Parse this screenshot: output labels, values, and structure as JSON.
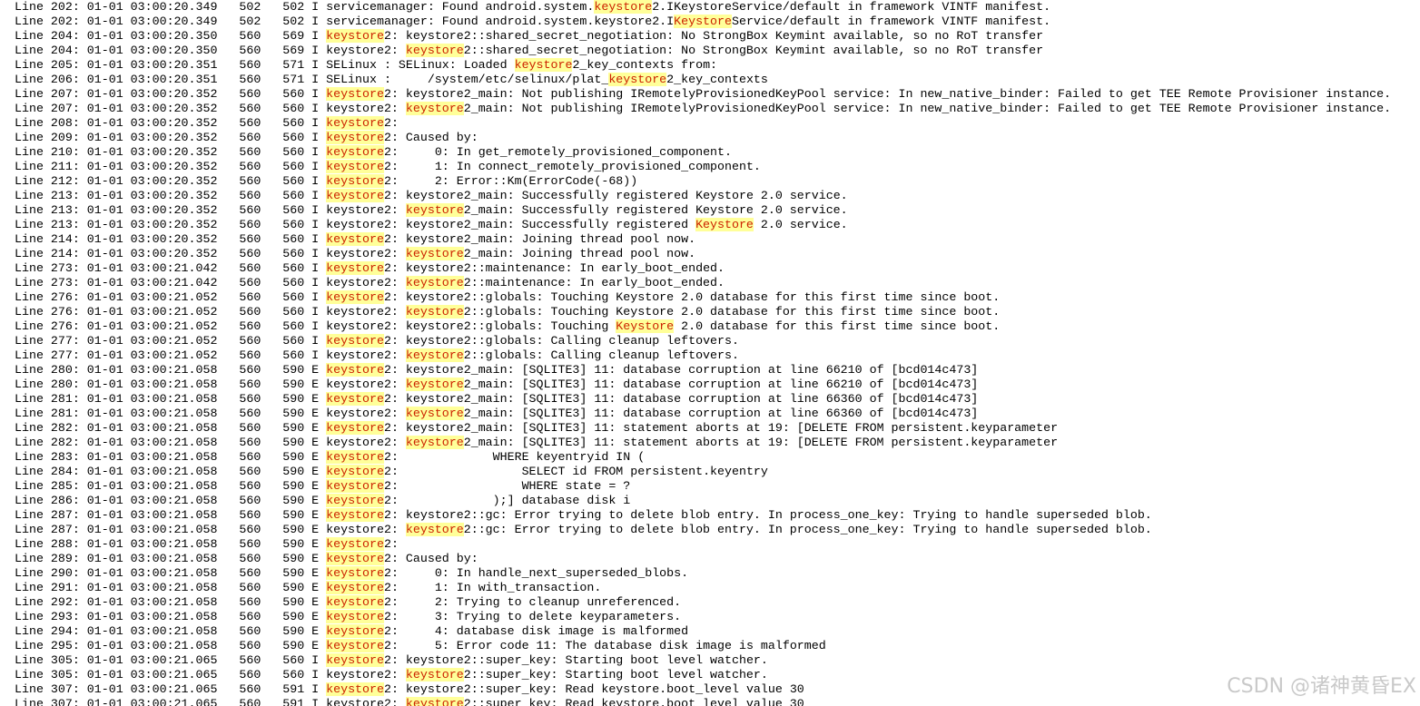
{
  "highlight_color": "#ffff99",
  "highlight_text_color": "#cc2200",
  "log_lines": [
    {
      "parts": [
        {
          "t": "Line 202: 01-01 03:00:20.349   502   502 I servicemanager: Found android.system."
        },
        {
          "t": "keystore",
          "hl": true
        },
        {
          "t": "2.IKeystoreService/default in framework VINTF manifest."
        }
      ]
    },
    {
      "parts": [
        {
          "t": "Line 202: 01-01 03:00:20.349   502   502 I servicemanager: Found android.system.keystore2.I"
        },
        {
          "t": "Keystore",
          "hl": true
        },
        {
          "t": "Service/default in framework VINTF manifest."
        }
      ]
    },
    {
      "parts": [
        {
          "t": "Line 204: 01-01 03:00:20.350   560   569 I "
        },
        {
          "t": "keystore",
          "hl": true
        },
        {
          "t": "2: keystore2::shared_secret_negotiation: No StrongBox Keymint available, so no RoT transfer"
        }
      ]
    },
    {
      "parts": [
        {
          "t": "Line 204: 01-01 03:00:20.350   560   569 I keystore2: "
        },
        {
          "t": "keystore",
          "hl": true
        },
        {
          "t": "2::shared_secret_negotiation: No StrongBox Keymint available, so no RoT transfer"
        }
      ]
    },
    {
      "parts": [
        {
          "t": "Line 205: 01-01 03:00:20.351   560   571 I SELinux : SELinux: Loaded "
        },
        {
          "t": "keystore",
          "hl": true
        },
        {
          "t": "2_key_contexts from:"
        }
      ]
    },
    {
      "parts": [
        {
          "t": "Line 206: 01-01 03:00:20.351   560   571 I SELinux :     /system/etc/selinux/plat_"
        },
        {
          "t": "keystore",
          "hl": true
        },
        {
          "t": "2_key_contexts"
        }
      ]
    },
    {
      "parts": [
        {
          "t": "Line 207: 01-01 03:00:20.352   560   560 I "
        },
        {
          "t": "keystore",
          "hl": true
        },
        {
          "t": "2: keystore2_main: Not publishing IRemotelyProvisionedKeyPool service: In new_native_binder: Failed to get TEE Remote Provisioner instance."
        }
      ]
    },
    {
      "parts": [
        {
          "t": "Line 207: 01-01 03:00:20.352   560   560 I keystore2: "
        },
        {
          "t": "keystore",
          "hl": true
        },
        {
          "t": "2_main: Not publishing IRemotelyProvisionedKeyPool service: In new_native_binder: Failed to get TEE Remote Provisioner instance."
        }
      ]
    },
    {
      "parts": [
        {
          "t": "Line 208: 01-01 03:00:20.352   560   560 I "
        },
        {
          "t": "keystore",
          "hl": true
        },
        {
          "t": "2:"
        }
      ]
    },
    {
      "parts": [
        {
          "t": "Line 209: 01-01 03:00:20.352   560   560 I "
        },
        {
          "t": "keystore",
          "hl": true
        },
        {
          "t": "2: Caused by:"
        }
      ]
    },
    {
      "parts": [
        {
          "t": "Line 210: 01-01 03:00:20.352   560   560 I "
        },
        {
          "t": "keystore",
          "hl": true
        },
        {
          "t": "2:     0: In get_remotely_provisioned_component."
        }
      ]
    },
    {
      "parts": [
        {
          "t": "Line 211: 01-01 03:00:20.352   560   560 I "
        },
        {
          "t": "keystore",
          "hl": true
        },
        {
          "t": "2:     1: In connect_remotely_provisioned_component."
        }
      ]
    },
    {
      "parts": [
        {
          "t": "Line 212: 01-01 03:00:20.352   560   560 I "
        },
        {
          "t": "keystore",
          "hl": true
        },
        {
          "t": "2:     2: Error::Km(ErrorCode(-68))"
        }
      ]
    },
    {
      "parts": [
        {
          "t": "Line 213: 01-01 03:00:20.352   560   560 I "
        },
        {
          "t": "keystore",
          "hl": true
        },
        {
          "t": "2: keystore2_main: Successfully registered Keystore 2.0 service."
        }
      ]
    },
    {
      "parts": [
        {
          "t": "Line 213: 01-01 03:00:20.352   560   560 I keystore2: "
        },
        {
          "t": "keystore",
          "hl": true
        },
        {
          "t": "2_main: Successfully registered Keystore 2.0 service."
        }
      ]
    },
    {
      "parts": [
        {
          "t": "Line 213: 01-01 03:00:20.352   560   560 I keystore2: keystore2_main: Successfully registered "
        },
        {
          "t": "Keystore",
          "hl": true
        },
        {
          "t": " 2.0 service."
        }
      ]
    },
    {
      "parts": [
        {
          "t": "Line 214: 01-01 03:00:20.352   560   560 I "
        },
        {
          "t": "keystore",
          "hl": true
        },
        {
          "t": "2: keystore2_main: Joining thread pool now."
        }
      ]
    },
    {
      "parts": [
        {
          "t": "Line 214: 01-01 03:00:20.352   560   560 I keystore2: "
        },
        {
          "t": "keystore",
          "hl": true
        },
        {
          "t": "2_main: Joining thread pool now."
        }
      ]
    },
    {
      "parts": [
        {
          "t": "Line 273: 01-01 03:00:21.042   560   560 I "
        },
        {
          "t": "keystore",
          "hl": true
        },
        {
          "t": "2: keystore2::maintenance: In early_boot_ended."
        }
      ]
    },
    {
      "parts": [
        {
          "t": "Line 273: 01-01 03:00:21.042   560   560 I keystore2: "
        },
        {
          "t": "keystore",
          "hl": true
        },
        {
          "t": "2::maintenance: In early_boot_ended."
        }
      ]
    },
    {
      "parts": [
        {
          "t": "Line 276: 01-01 03:00:21.052   560   560 I "
        },
        {
          "t": "keystore",
          "hl": true
        },
        {
          "t": "2: keystore2::globals: Touching Keystore 2.0 database for this first time since boot."
        }
      ]
    },
    {
      "parts": [
        {
          "t": "Line 276: 01-01 03:00:21.052   560   560 I keystore2: "
        },
        {
          "t": "keystore",
          "hl": true
        },
        {
          "t": "2::globals: Touching Keystore 2.0 database for this first time since boot."
        }
      ]
    },
    {
      "parts": [
        {
          "t": "Line 276: 01-01 03:00:21.052   560   560 I keystore2: keystore2::globals: Touching "
        },
        {
          "t": "Keystore",
          "hl": true
        },
        {
          "t": " 2.0 database for this first time since boot."
        }
      ]
    },
    {
      "parts": [
        {
          "t": "Line 277: 01-01 03:00:21.052   560   560 I "
        },
        {
          "t": "keystore",
          "hl": true
        },
        {
          "t": "2: keystore2::globals: Calling cleanup leftovers."
        }
      ]
    },
    {
      "parts": [
        {
          "t": "Line 277: 01-01 03:00:21.052   560   560 I keystore2: "
        },
        {
          "t": "keystore",
          "hl": true
        },
        {
          "t": "2::globals: Calling cleanup leftovers."
        }
      ]
    },
    {
      "parts": [
        {
          "t": "Line 280: 01-01 03:00:21.058   560   590 E "
        },
        {
          "t": "keystore",
          "hl": true
        },
        {
          "t": "2: keystore2_main: [SQLITE3] 11: database corruption at line 66210 of [bcd014c473]"
        }
      ]
    },
    {
      "parts": [
        {
          "t": "Line 280: 01-01 03:00:21.058   560   590 E keystore2: "
        },
        {
          "t": "keystore",
          "hl": true
        },
        {
          "t": "2_main: [SQLITE3] 11: database corruption at line 66210 of [bcd014c473]"
        }
      ]
    },
    {
      "parts": [
        {
          "t": "Line 281: 01-01 03:00:21.058   560   590 E "
        },
        {
          "t": "keystore",
          "hl": true
        },
        {
          "t": "2: keystore2_main: [SQLITE3] 11: database corruption at line 66360 of [bcd014c473]"
        }
      ]
    },
    {
      "parts": [
        {
          "t": "Line 281: 01-01 03:00:21.058   560   590 E keystore2: "
        },
        {
          "t": "keystore",
          "hl": true
        },
        {
          "t": "2_main: [SQLITE3] 11: database corruption at line 66360 of [bcd014c473]"
        }
      ]
    },
    {
      "parts": [
        {
          "t": "Line 282: 01-01 03:00:21.058   560   590 E "
        },
        {
          "t": "keystore",
          "hl": true
        },
        {
          "t": "2: keystore2_main: [SQLITE3] 11: statement aborts at 19: [DELETE FROM persistent.keyparameter"
        }
      ]
    },
    {
      "parts": [
        {
          "t": "Line 282: 01-01 03:00:21.058   560   590 E keystore2: "
        },
        {
          "t": "keystore",
          "hl": true
        },
        {
          "t": "2_main: [SQLITE3] 11: statement aborts at 19: [DELETE FROM persistent.keyparameter"
        }
      ]
    },
    {
      "parts": [
        {
          "t": "Line 283: 01-01 03:00:21.058   560   590 E "
        },
        {
          "t": "keystore",
          "hl": true
        },
        {
          "t": "2:             WHERE keyentryid IN ("
        }
      ]
    },
    {
      "parts": [
        {
          "t": "Line 284: 01-01 03:00:21.058   560   590 E "
        },
        {
          "t": "keystore",
          "hl": true
        },
        {
          "t": "2:                 SELECT id FROM persistent.keyentry"
        }
      ]
    },
    {
      "parts": [
        {
          "t": "Line 285: 01-01 03:00:21.058   560   590 E "
        },
        {
          "t": "keystore",
          "hl": true
        },
        {
          "t": "2:                 WHERE state = ?"
        }
      ]
    },
    {
      "parts": [
        {
          "t": "Line 286: 01-01 03:00:21.058   560   590 E "
        },
        {
          "t": "keystore",
          "hl": true
        },
        {
          "t": "2:             );] database disk i"
        }
      ]
    },
    {
      "parts": [
        {
          "t": "Line 287: 01-01 03:00:21.058   560   590 E "
        },
        {
          "t": "keystore",
          "hl": true
        },
        {
          "t": "2: keystore2::gc: Error trying to delete blob entry. In process_one_key: Trying to handle superseded blob."
        }
      ]
    },
    {
      "parts": [
        {
          "t": "Line 287: 01-01 03:00:21.058   560   590 E keystore2: "
        },
        {
          "t": "keystore",
          "hl": true
        },
        {
          "t": "2::gc: Error trying to delete blob entry. In process_one_key: Trying to handle superseded blob."
        }
      ]
    },
    {
      "parts": [
        {
          "t": "Line 288: 01-01 03:00:21.058   560   590 E "
        },
        {
          "t": "keystore",
          "hl": true
        },
        {
          "t": "2:"
        }
      ]
    },
    {
      "parts": [
        {
          "t": "Line 289: 01-01 03:00:21.058   560   590 E "
        },
        {
          "t": "keystore",
          "hl": true
        },
        {
          "t": "2: Caused by:"
        }
      ]
    },
    {
      "parts": [
        {
          "t": "Line 290: 01-01 03:00:21.058   560   590 E "
        },
        {
          "t": "keystore",
          "hl": true
        },
        {
          "t": "2:     0: In handle_next_superseded_blobs."
        }
      ]
    },
    {
      "parts": [
        {
          "t": "Line 291: 01-01 03:00:21.058   560   590 E "
        },
        {
          "t": "keystore",
          "hl": true
        },
        {
          "t": "2:     1: In with_transaction."
        }
      ]
    },
    {
      "parts": [
        {
          "t": "Line 292: 01-01 03:00:21.058   560   590 E "
        },
        {
          "t": "keystore",
          "hl": true
        },
        {
          "t": "2:     2: Trying to cleanup unreferenced."
        }
      ]
    },
    {
      "parts": [
        {
          "t": "Line 293: 01-01 03:00:21.058   560   590 E "
        },
        {
          "t": "keystore",
          "hl": true
        },
        {
          "t": "2:     3: Trying to delete keyparameters."
        }
      ]
    },
    {
      "parts": [
        {
          "t": "Line 294: 01-01 03:00:21.058   560   590 E "
        },
        {
          "t": "keystore",
          "hl": true
        },
        {
          "t": "2:     4: database disk image is malformed"
        }
      ]
    },
    {
      "parts": [
        {
          "t": "Line 295: 01-01 03:00:21.058   560   590 E "
        },
        {
          "t": "keystore",
          "hl": true
        },
        {
          "t": "2:     5: Error code 11: The database disk image is malformed"
        }
      ]
    },
    {
      "parts": [
        {
          "t": "Line 305: 01-01 03:00:21.065   560   560 I "
        },
        {
          "t": "keystore",
          "hl": true
        },
        {
          "t": "2: keystore2::super_key: Starting boot level watcher."
        }
      ]
    },
    {
      "parts": [
        {
          "t": "Line 305: 01-01 03:00:21.065   560   560 I keystore2: "
        },
        {
          "t": "keystore",
          "hl": true
        },
        {
          "t": "2::super_key: Starting boot level watcher."
        }
      ]
    },
    {
      "parts": [
        {
          "t": "Line 307: 01-01 03:00:21.065   560   591 I "
        },
        {
          "t": "keystore",
          "hl": true
        },
        {
          "t": "2: keystore2::super_key: Read keystore.boot_level value 30"
        }
      ]
    },
    {
      "parts": [
        {
          "t": "Line 307: 01-01 03:00:21.065   560   591 I keystore2: "
        },
        {
          "t": "keystore",
          "hl": true
        },
        {
          "t": "2::super_key: Read keystore.boot_level value 30"
        }
      ]
    }
  ],
  "watermark": "CSDN @诸神黄昏EX"
}
